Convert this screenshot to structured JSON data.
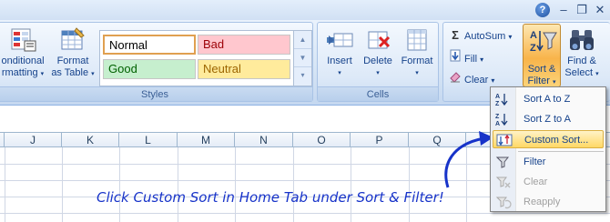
{
  "title_bar": {
    "help_glyph": "?",
    "minimize": "–",
    "restore": "❐",
    "close": "✕"
  },
  "styles_group": {
    "conditional_formatting": {
      "line1": "onditional",
      "line2": "rmatting",
      "caret": "▾"
    },
    "format_as_table": {
      "line1": "Format",
      "line2": "as Table",
      "caret": "▾"
    },
    "gallery": [
      {
        "label": "Normal",
        "bg": "#ffffff",
        "fg": "#000000"
      },
      {
        "label": "Bad",
        "bg": "#ffc7ce",
        "fg": "#9c0006"
      },
      {
        "label": "Good",
        "bg": "#c6efce",
        "fg": "#006100"
      },
      {
        "label": "Neutral",
        "bg": "#ffeb9c",
        "fg": "#9c6500"
      }
    ],
    "label": "Styles"
  },
  "cells_group": {
    "insert": {
      "label": "Insert",
      "caret": "▾"
    },
    "delete": {
      "label": "Delete",
      "caret": "▾"
    },
    "format": {
      "label": "Format",
      "caret": "▾"
    },
    "label": "Cells"
  },
  "editing_group": {
    "autosum": {
      "icon": "Σ",
      "label": "AutoSum",
      "caret": "▾"
    },
    "fill": {
      "label": "Fill",
      "caret": "▾"
    },
    "clear": {
      "label": "Clear",
      "caret": "▾"
    },
    "sort_filter": {
      "line1": "Sort &",
      "line2": "Filter",
      "caret": "▾"
    },
    "find_select": {
      "line1": "Find &",
      "line2": "Select",
      "caret": "▾"
    }
  },
  "sheet": {
    "columns": [
      "J",
      "K",
      "L",
      "M",
      "N",
      "O",
      "P",
      "Q"
    ]
  },
  "sort_menu": {
    "items": [
      {
        "label": "Sort A to Z",
        "icon": "A↓Z",
        "state": "normal"
      },
      {
        "label": "Sort Z to A",
        "icon": "Z↓A",
        "state": "normal"
      },
      {
        "label": "Custom Sort...",
        "icon": "⇅",
        "state": "highlighted"
      },
      {
        "label": "Filter",
        "icon": "▼",
        "state": "normal"
      },
      {
        "label": "Clear",
        "icon": "✕",
        "state": "disabled"
      },
      {
        "label": "Reapply",
        "icon": "↻",
        "state": "disabled"
      }
    ]
  },
  "annotation": {
    "text": "Click Custom Sort in Home Tab under Sort & Filter!",
    "color": "#1733c9"
  }
}
